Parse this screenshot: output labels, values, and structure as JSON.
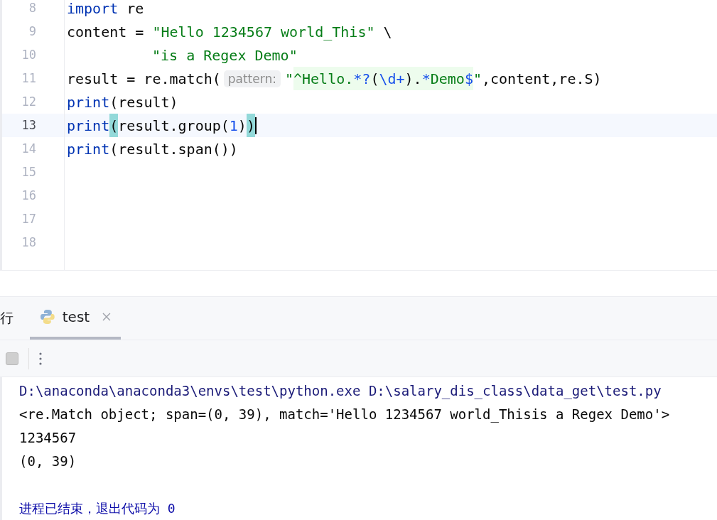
{
  "editor": {
    "lines": [
      {
        "number": "8",
        "current": false,
        "tokens": [
          {
            "kind": "keyword",
            "text": "import"
          },
          {
            "kind": "plain",
            "text": " re"
          }
        ]
      },
      {
        "number": "9",
        "current": false,
        "tokens": [
          {
            "kind": "plain",
            "text": "content = "
          },
          {
            "kind": "string",
            "text": "\"Hello 1234567 world_This\""
          },
          {
            "kind": "plain",
            "text": " \\"
          }
        ]
      },
      {
        "number": "10",
        "current": false,
        "continuation": true,
        "tokens": [
          {
            "kind": "string",
            "text": "\"is a Regex Demo\""
          }
        ]
      },
      {
        "number": "11",
        "current": false,
        "tokens": [
          {
            "kind": "plain",
            "text": "result = re.match("
          },
          {
            "kind": "hint",
            "text": "pattern:"
          },
          {
            "kind": "string",
            "text": "\""
          },
          {
            "kind": "regex",
            "text": "^Hello."
          },
          {
            "kind": "regex-op",
            "text": "*?"
          },
          {
            "kind": "regex-group",
            "text": "("
          },
          {
            "kind": "regex-op",
            "text": "\\d+"
          },
          {
            "kind": "regex-group",
            "text": ")."
          },
          {
            "kind": "regex-op",
            "text": "*"
          },
          {
            "kind": "regex",
            "text": "Demo"
          },
          {
            "kind": "regex-op",
            "text": "$"
          },
          {
            "kind": "string",
            "text": "\""
          },
          {
            "kind": "plain",
            "text": ",content,re.S)"
          }
        ]
      },
      {
        "number": "12",
        "current": false,
        "tokens": [
          {
            "kind": "keyword",
            "text": "print"
          },
          {
            "kind": "plain",
            "text": "(result)"
          }
        ]
      },
      {
        "number": "13",
        "current": true,
        "tokens": [
          {
            "kind": "keyword",
            "text": "print"
          },
          {
            "kind": "brace-match",
            "text": "("
          },
          {
            "kind": "plain",
            "text": "result.group("
          },
          {
            "kind": "number",
            "text": "1"
          },
          {
            "kind": "plain",
            "text": ")"
          },
          {
            "kind": "brace-match",
            "text": ")"
          }
        ]
      },
      {
        "number": "14",
        "current": false,
        "tokens": [
          {
            "kind": "keyword",
            "text": "print"
          },
          {
            "kind": "plain",
            "text": "(result.span())"
          }
        ]
      },
      {
        "number": "15",
        "current": false
      },
      {
        "number": "16",
        "current": false
      },
      {
        "number": "17",
        "current": false
      },
      {
        "number": "18",
        "current": false
      }
    ]
  },
  "run_panel": {
    "title": "行",
    "tabs": [
      {
        "label": "test",
        "selected": true
      }
    ]
  },
  "console": {
    "lines": [
      {
        "kind": "command",
        "text": "D:\\anaconda\\anaconda3\\envs\\test\\python.exe D:\\salary_dis_class\\data_get\\test.py"
      },
      {
        "kind": "stdout",
        "text": "<re.Match object; span=(0, 39), match='Hello 1234567 world_Thisis a Regex Demo'>"
      },
      {
        "kind": "stdout",
        "text": "1234567"
      },
      {
        "kind": "stdout",
        "text": "(0, 39)"
      },
      {
        "kind": "blank"
      },
      {
        "kind": "exit",
        "text": "进程已结束，退出代码为 0"
      }
    ]
  }
}
